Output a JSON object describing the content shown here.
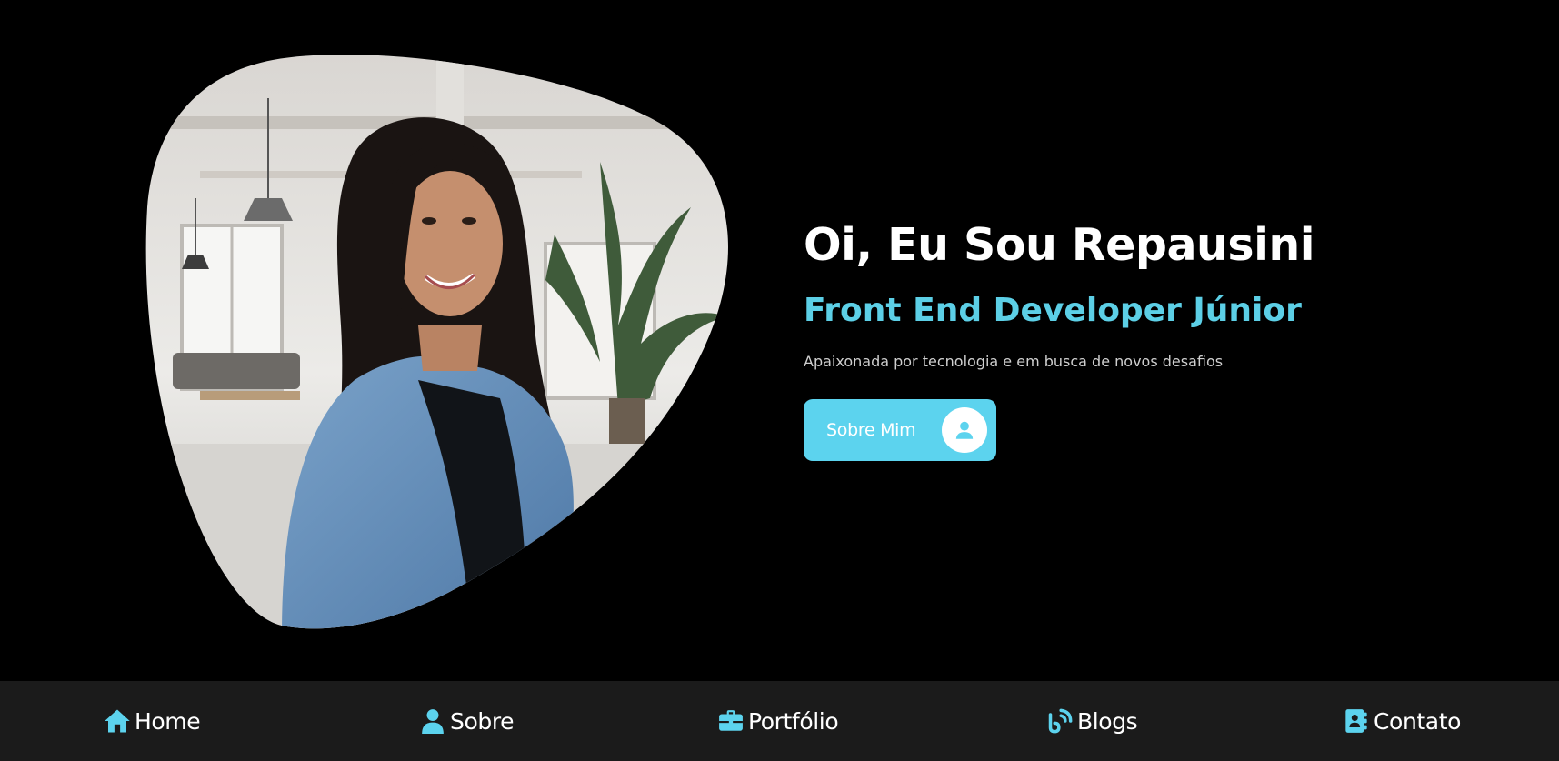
{
  "hero": {
    "photo_alt": "Portrait of Repausini in an office",
    "title": "Oi, Eu Sou Repausini",
    "subtitle": "Front End Developer Júnior",
    "description": "Apaixonada por tecnologia e em busca de novos desafios",
    "cta_label": "Sobre Mim",
    "cta_icon": "user-circle-icon"
  },
  "nav": {
    "items": [
      {
        "label": "Home",
        "icon": "home-icon"
      },
      {
        "label": "Sobre",
        "icon": "user-icon"
      },
      {
        "label": "Portfólio",
        "icon": "briefcase-icon"
      },
      {
        "label": "Blogs",
        "icon": "blog-icon"
      },
      {
        "label": "Contato",
        "icon": "contact-book-icon"
      }
    ]
  },
  "colors": {
    "background": "#000000",
    "accent": "#5cd3ee",
    "subtitle": "#5ccfe6",
    "nav_background": "#1b1b1b"
  }
}
